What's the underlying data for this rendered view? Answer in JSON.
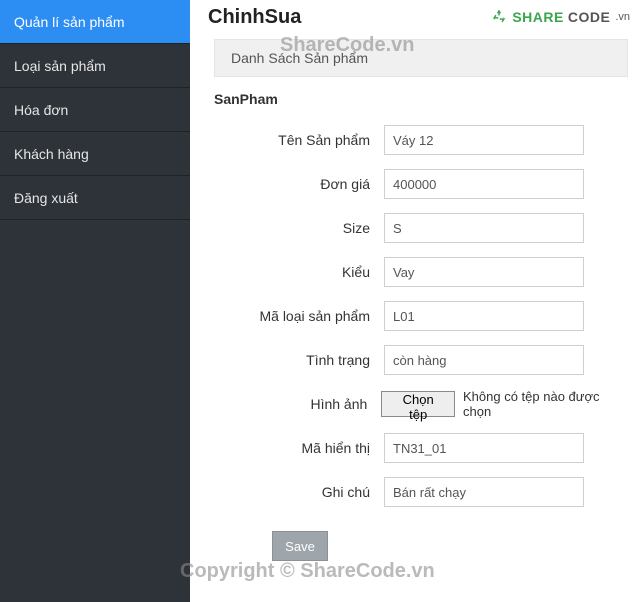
{
  "sidebar": {
    "items": [
      {
        "label": "Quản lí sản phẩm",
        "active": true
      },
      {
        "label": "Loại sản phẩm",
        "active": false
      },
      {
        "label": "Hóa đơn",
        "active": false
      },
      {
        "label": "Khách hàng",
        "active": false
      },
      {
        "label": "Đăng xuất",
        "active": false
      }
    ]
  },
  "header": {
    "title": "ChinhSua",
    "breadcrumb": "Danh Sách Sản phẩm",
    "section": "SanPham"
  },
  "form": {
    "labels": {
      "ten": "Tên Sản phẩm",
      "dongia": "Đơn giá",
      "size": "Size",
      "kieu": "Kiểu",
      "maloai": "Mã loại sản phẩm",
      "tinhtrang": "Tình trạng",
      "hinhanh": "Hình ảnh",
      "mahienthi": "Mã hiển thị",
      "ghichu": "Ghi chú"
    },
    "values": {
      "ten": "Váy 12",
      "dongia": "400000",
      "size": "S",
      "kieu": "Vay",
      "maloai": "L01",
      "tinhtrang": "còn hàng",
      "mahienthi": "TN31_01",
      "ghichu": "Bán rất chạy"
    },
    "file": {
      "button": "Chọn tệp",
      "status": "Không có tệp nào được chọn"
    },
    "save": "Save"
  },
  "watermark": {
    "top": "ShareCode.vn",
    "bottom": "Copyright © ShareCode.vn",
    "logo_share": "SHARE",
    "logo_code": "CODE",
    "logo_vn": ".vn"
  }
}
